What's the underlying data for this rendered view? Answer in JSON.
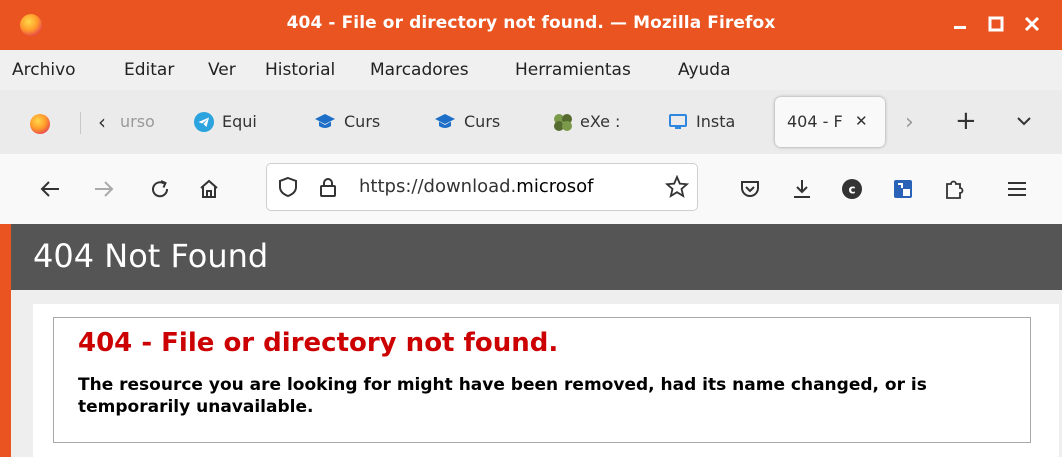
{
  "window": {
    "title": "404 - File or directory not found. — Mozilla Firefox",
    "controls": {
      "minimize": "–",
      "maximize": "□",
      "close": "✕"
    }
  },
  "menu": {
    "items": [
      "Archivo",
      "Editar",
      "Ver",
      "Historial",
      "Marcadores",
      "Herramientas",
      "Ayuda"
    ]
  },
  "tabs": {
    "items": [
      {
        "label": "urso",
        "icon": "chevron-left-icon"
      },
      {
        "label": "Equi",
        "icon": "telegram-icon"
      },
      {
        "label": "Curs",
        "icon": "graduation-cap-icon"
      },
      {
        "label": "Curs",
        "icon": "graduation-cap-icon"
      },
      {
        "label": "eXe :",
        "icon": "exe-icon"
      },
      {
        "label": "Insta",
        "icon": "monitor-icon"
      },
      {
        "label": "404 - F",
        "icon": "",
        "active": true
      }
    ],
    "close_glyph": "✕",
    "new_tab": "+"
  },
  "nav": {
    "url_prefix": "https://download.",
    "url_domain": "microsof"
  },
  "page": {
    "header": "404 Not Found",
    "error_title": "404 - File or directory not found.",
    "error_message": "The resource you are looking for might have been removed, had its name changed, or is temporarily unavailable."
  },
  "colors": {
    "titlebar": "#e95420",
    "error_red": "#cc0000",
    "header_bg": "#555555"
  }
}
